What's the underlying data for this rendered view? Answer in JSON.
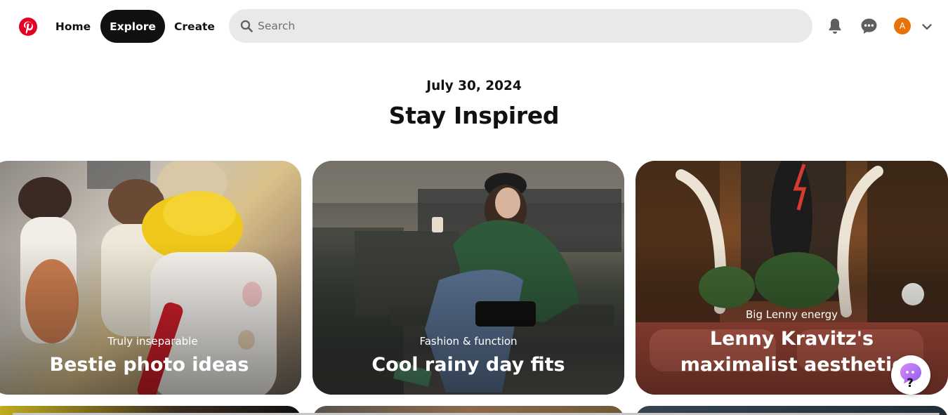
{
  "header": {
    "logo_icon": "pinterest-logo",
    "nav": [
      {
        "label": "Home",
        "active": false
      },
      {
        "label": "Explore",
        "active": true
      },
      {
        "label": "Create",
        "active": false
      }
    ],
    "search": {
      "placeholder": "Search",
      "icon": "search-icon"
    },
    "notifications_icon": "bell-icon",
    "messages_icon": "chat-icon",
    "avatar_initial": "A",
    "avatar_color": "#e8710a",
    "account_menu_icon": "chevron-down-icon"
  },
  "page": {
    "date": "July 30, 2024",
    "title": "Stay Inspired"
  },
  "cards": [
    {
      "subtitle": "Truly inseparable",
      "title": "Bestie photo ideas"
    },
    {
      "subtitle": "Fashion & function",
      "title": "Cool rainy day fits"
    },
    {
      "subtitle": "Big Lenny energy",
      "title": "Lenny Kravitz's maximalist aesthetic"
    }
  ],
  "help_button_icon": "help-icon",
  "colors": {
    "brand_red": "#e60023",
    "active_nav_bg": "#111111",
    "search_bg": "#e9e9e9"
  }
}
